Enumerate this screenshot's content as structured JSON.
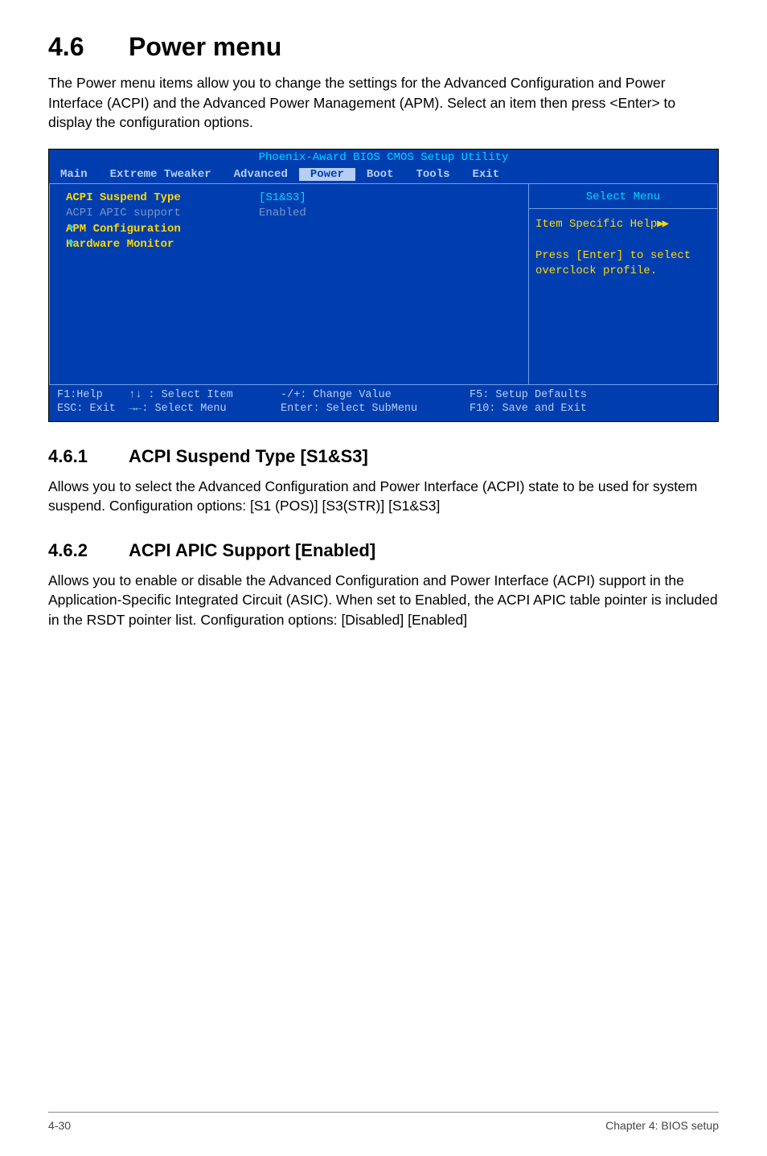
{
  "section": {
    "number": "4.6",
    "title": "Power menu"
  },
  "intro": "The Power menu items allow you to change the settings for the Advanced Configuration and Power Interface (ACPI) and the Advanced Power Management (APM). Select an item then press <Enter> to display the configuration options.",
  "bios": {
    "topTitle": "Phoenix-Award BIOS CMOS Setup Utility",
    "menu": [
      "Main",
      "Extreme Tweaker",
      "Advanced",
      "Power",
      "Boot",
      "Tools",
      "Exit"
    ],
    "active": "Power",
    "options": [
      {
        "label": "ACPI Suspend Type",
        "value": "[S1&S3]",
        "dim": false,
        "tri": false
      },
      {
        "label": "ACPI APIC support",
        "value": "Enabled",
        "dim": true,
        "tri": false
      },
      {
        "label": "APM Configuration",
        "value": "",
        "dim": false,
        "tri": true
      },
      {
        "label": "Hardware Monitor",
        "value": "",
        "dim": false,
        "tri": true
      }
    ],
    "help": {
      "title": "Select Menu",
      "line1": "Item Specific Help",
      "line2": "Press [Enter] to select overclock profile."
    },
    "footer": {
      "c1a": "F1:Help    ↑↓ : Select Item",
      "c1b": "ESC: Exit  →←: Select Menu",
      "c2a": "-/+: Change Value",
      "c2b": "Enter: Select SubMenu",
      "c3a": "F5: Setup Defaults",
      "c3b": "F10: Save and Exit"
    }
  },
  "sub1": {
    "number": "4.6.1",
    "title": "ACPI Suspend Type [S1&S3]",
    "body": "Allows you to select the Advanced Configuration and Power Interface (ACPI) state to be used for system suspend. Configuration options: [S1 (POS)] [S3(STR)] [S1&S3]"
  },
  "sub2": {
    "number": "4.6.2",
    "title": "ACPI APIC Support [Enabled]",
    "body": "Allows you to enable or disable the Advanced Configuration and Power Interface (ACPI) support in the Application-Specific Integrated Circuit (ASIC). When set to Enabled, the ACPI APIC table pointer is included in the RSDT pointer list. Configuration options: [Disabled] [Enabled]"
  },
  "footer": {
    "left": "4-30",
    "right": "Chapter 4: BIOS setup"
  }
}
